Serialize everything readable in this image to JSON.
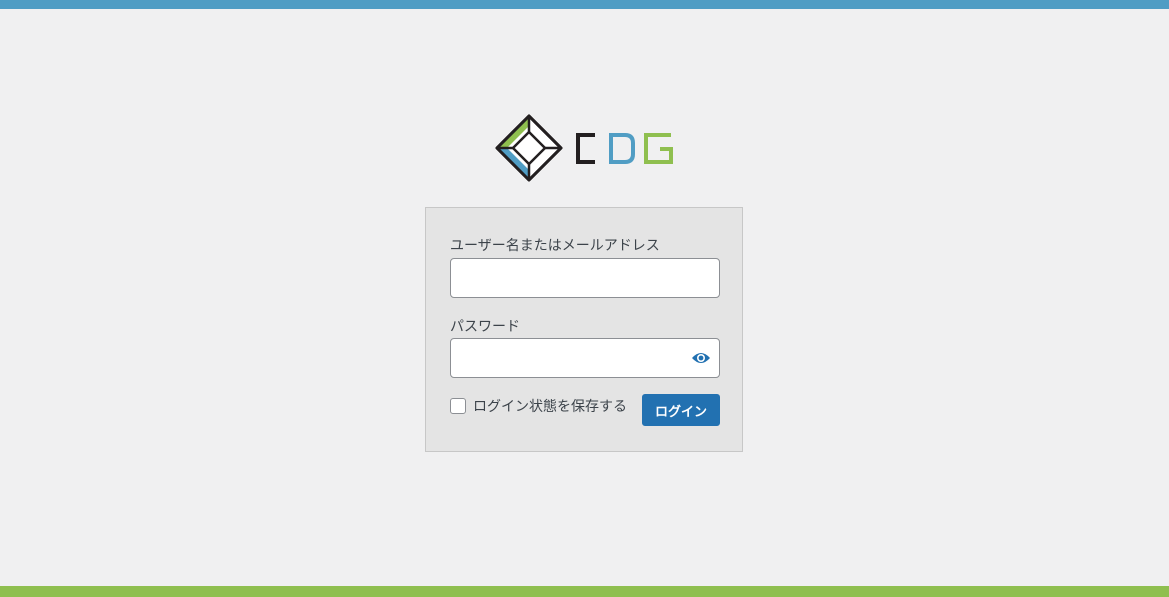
{
  "colors": {
    "top_bar": "#509dc4",
    "bottom_bar": "#8fbf4f",
    "background": "#f0f0f1",
    "primary_button": "#2271b1",
    "logo_green": "#8fbf4f",
    "logo_blue": "#509dc4",
    "logo_dark": "#231f20"
  },
  "logo": {
    "text": "CDG",
    "icon": "diamond-logo-icon"
  },
  "form": {
    "username_label": "ユーザー名またはメールアドレス",
    "username_value": "",
    "password_label": "パスワード",
    "password_value": "",
    "show_password_icon": "eye-icon",
    "remember_label": "ログイン状態を保存する",
    "remember_checked": false,
    "submit_label": "ログイン"
  }
}
